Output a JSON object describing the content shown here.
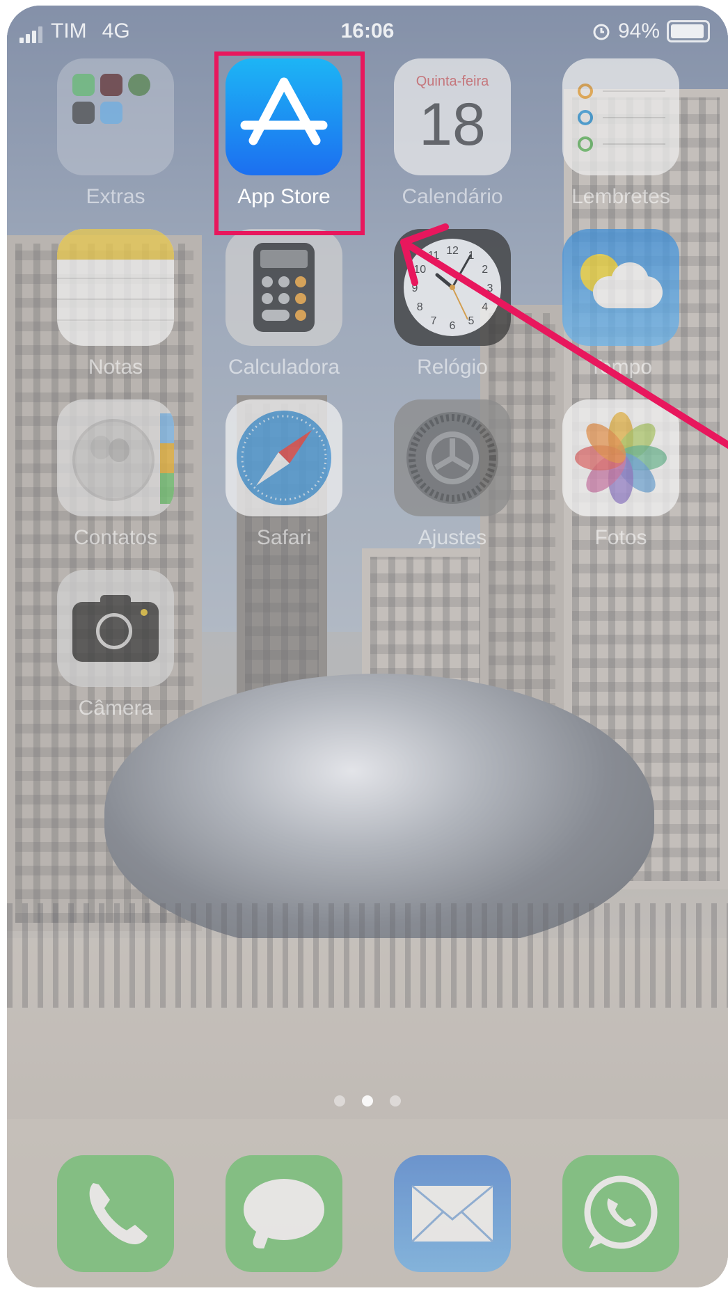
{
  "status_bar": {
    "carrier": "TIM",
    "network": "4G",
    "time": "16:06",
    "battery": "94%",
    "battery_level": 0.94
  },
  "calendar": {
    "weekday": "Quinta-feira",
    "day": "18"
  },
  "apps": {
    "extras": "Extras",
    "app_store": "App Store",
    "calendar": "Calendário",
    "reminders": "Lembretes",
    "notes": "Notas",
    "calculator": "Calculadora",
    "clock": "Relógio",
    "weather": "Tempo",
    "contacts": "Contatos",
    "safari": "Safari",
    "settings": "Ajustes",
    "photos": "Fotos",
    "camera": "Câmera"
  },
  "clock_numbers": [
    "12",
    "1",
    "2",
    "3",
    "4",
    "5",
    "6",
    "7",
    "8",
    "9",
    "10",
    "11"
  ],
  "page_indicator": {
    "count": 3,
    "current": 2
  },
  "dock": [
    "phone-icon",
    "messages-icon",
    "mail-icon",
    "whatsapp-icon"
  ],
  "colors": {
    "highlight": "#e8175d",
    "app_store_blue": "#1c8ff2"
  }
}
